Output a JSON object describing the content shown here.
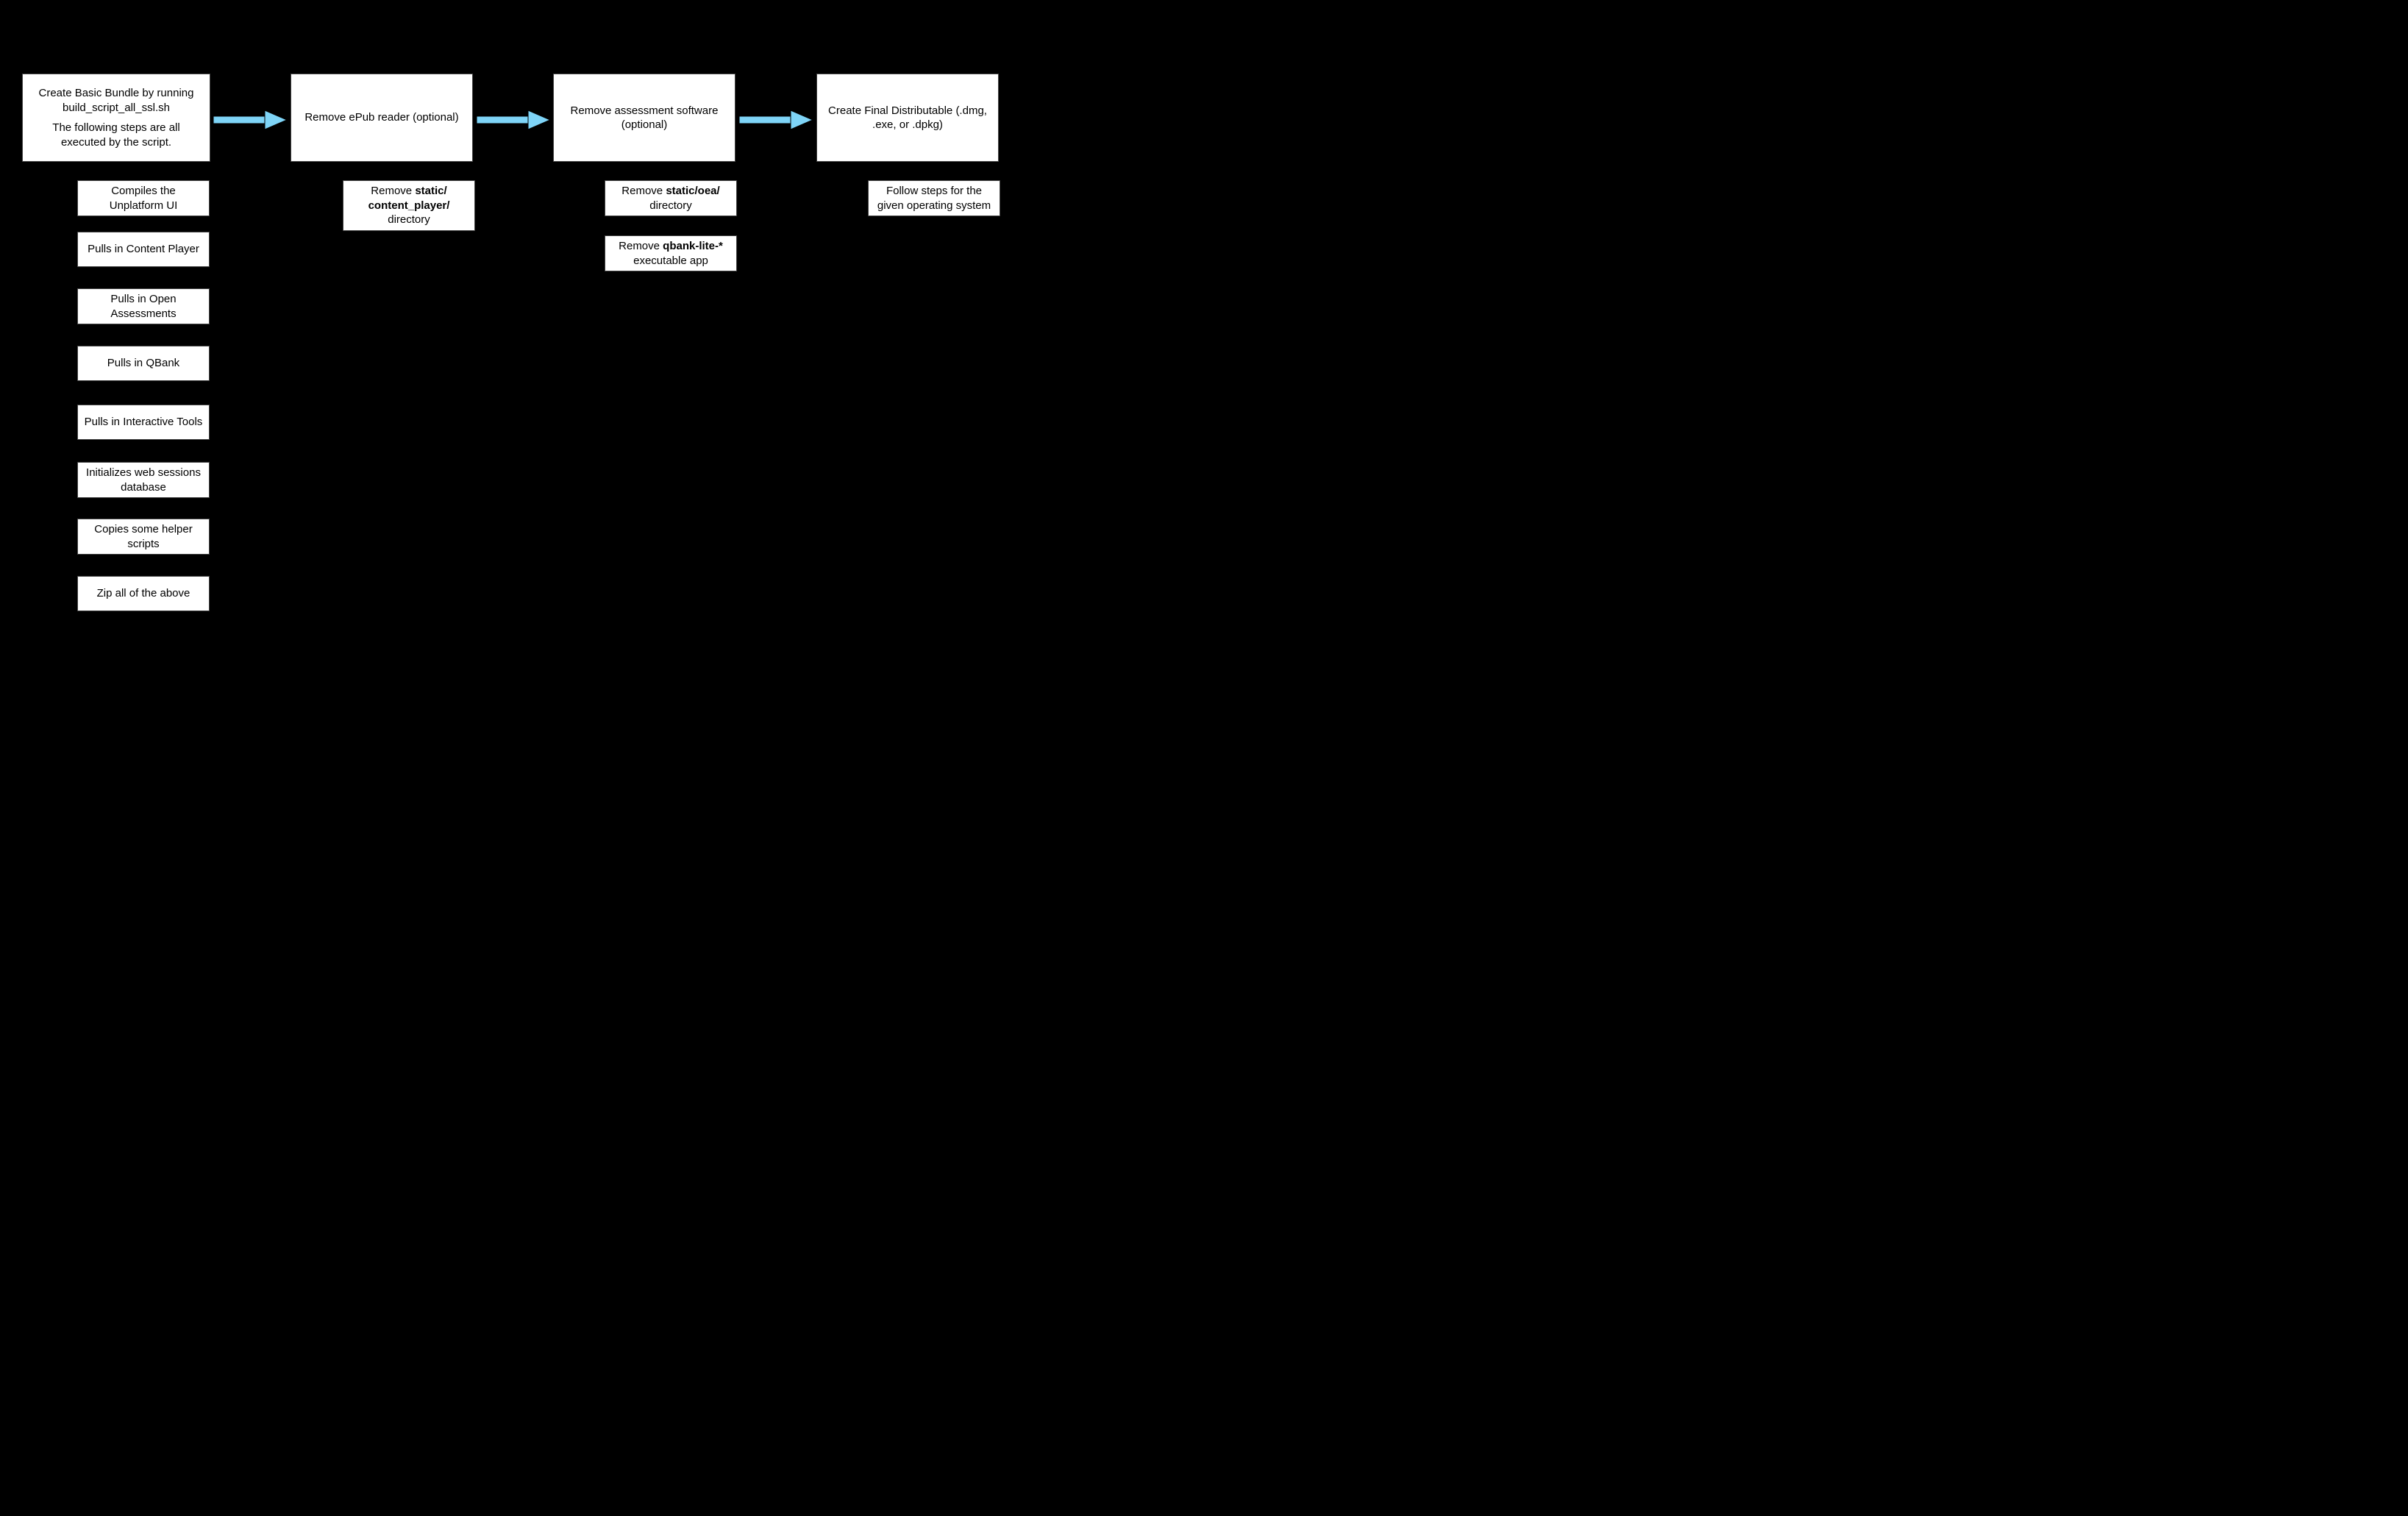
{
  "stages": [
    {
      "id": "stage1",
      "title_line1": "Create Basic Bundle by running build_script_all_ssl.sh",
      "title_line2": "The following steps are all executed by the script.",
      "subs": [
        "Compiles the Unplatform UI",
        "Pulls in Content Player",
        "Pulls in Open Assessments",
        "Pulls in QBank",
        "Pulls in Interactive Tools",
        "Initializes web sessions database",
        "Copies some helper scripts",
        "Zip all of the above"
      ]
    },
    {
      "id": "stage2",
      "title": "Remove ePub reader (optional)",
      "subs_html": [
        "Remove <b>static/ content_player/</b> directory"
      ]
    },
    {
      "id": "stage3",
      "title": "Remove assessment software (optional)",
      "subs_html": [
        "Remove <b>static/oea/</b> directory",
        "Remove <b>qbank-lite-*</b> executable app"
      ]
    },
    {
      "id": "stage4",
      "title": "Create Final Distributable (.dmg, .exe, or .dpkg)",
      "subs": [
        "Follow steps for the given operating system"
      ]
    }
  ],
  "arrow_color": "#7ed4f7"
}
